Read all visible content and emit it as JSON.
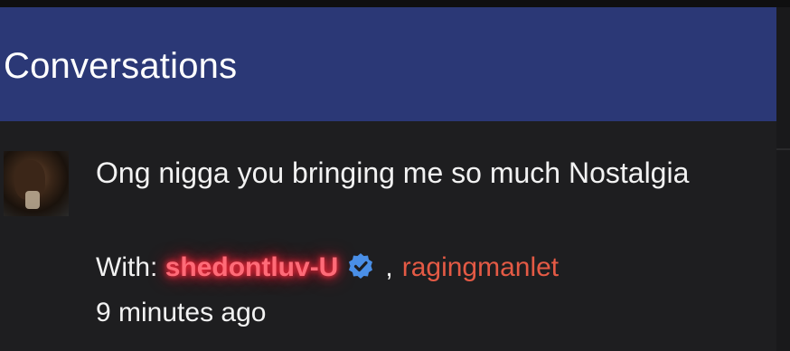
{
  "header": {
    "title": "Conversations"
  },
  "conversation": {
    "message_preview": "Ong nigga you bringing me so much Nostalgia",
    "with_label": "With:",
    "participants": [
      {
        "name": "shedontluv-U",
        "verified": true,
        "style": "glowing-red"
      },
      {
        "name": "ragingmanlet",
        "verified": false
      }
    ],
    "separator": ",",
    "timestamp": "9 minutes ago"
  },
  "icons": {
    "verified": "verified-badge-icon",
    "avatar": "user-avatar"
  },
  "colors": {
    "header_bg": "#2b3876",
    "content_bg": "#1e1e20",
    "text": "#f2f2f2",
    "user_glow": "#ff2a3d",
    "user_link": "#e45a45",
    "verified_blue": "#4a8fe7"
  }
}
